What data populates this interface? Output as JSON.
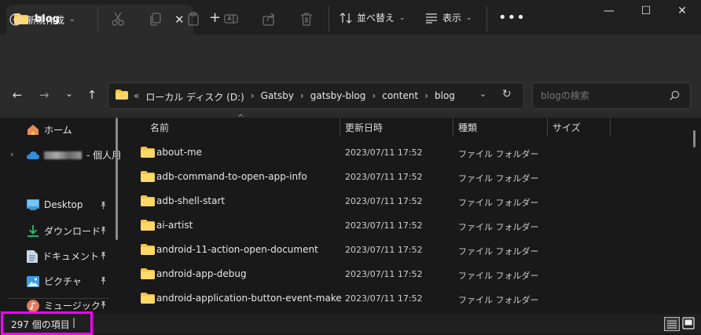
{
  "tab": {
    "title": "blog",
    "close": "✕",
    "new_tab": "+"
  },
  "window": {
    "minimize": "—",
    "maximize": "☐",
    "close": "✕"
  },
  "toolbar": {
    "new_label": "新規作成",
    "sort_label": "並べ替え",
    "view_label": "表示",
    "more": "•••",
    "chevron": "⌄"
  },
  "nav": {
    "back": "←",
    "forward": "→",
    "recent": "⌄",
    "up": "↑"
  },
  "address": {
    "prefix": "«",
    "crumbs": [
      "ローカル ディスク (D:)",
      "Gatsby",
      "gatsby-blog",
      "content",
      "blog"
    ],
    "separator": "›",
    "dropdown": "⌄",
    "refresh": "↻"
  },
  "search": {
    "placeholder": "blogの検索"
  },
  "sidebar": {
    "home": "ホーム",
    "onedrive_suffix": "- 個人用",
    "items": [
      {
        "label": "Desktop",
        "icon": "desktop-icon"
      },
      {
        "label": "ダウンロード",
        "icon": "download-icon"
      },
      {
        "label": "ドキュメント",
        "icon": "document-icon"
      },
      {
        "label": "ピクチャ",
        "icon": "picture-icon"
      },
      {
        "label": "ミュージック",
        "icon": "music-icon"
      }
    ],
    "pin": "📌"
  },
  "columns": {
    "name": "名前",
    "modified": "更新日時",
    "type": "種類",
    "size": "サイズ",
    "sort_caret": "^"
  },
  "rows": [
    {
      "name": "about-me",
      "modified": "2023/07/11 17:52",
      "type": "ファイル フォルダー"
    },
    {
      "name": "adb-command-to-open-app-info",
      "modified": "2023/07/11 17:52",
      "type": "ファイル フォルダー"
    },
    {
      "name": "adb-shell-start",
      "modified": "2023/07/11 17:52",
      "type": "ファイル フォルダー"
    },
    {
      "name": "ai-artist",
      "modified": "2023/07/11 17:52",
      "type": "ファイル フォルダー"
    },
    {
      "name": "android-11-action-open-document",
      "modified": "2023/07/11 17:52",
      "type": "ファイル フォルダー"
    },
    {
      "name": "android-app-debug",
      "modified": "2023/07/11 17:52",
      "type": "ファイル フォルダー"
    },
    {
      "name": "android-application-button-event-make",
      "modified": "2023/07/11 17:52",
      "type": "ファイル フォルダー"
    }
  ],
  "status": {
    "item_count": "297 個の項目",
    "cursor": "|"
  },
  "colors": {
    "folder": "#f6c445",
    "accent_box": "#ff00ff",
    "background": "#191919"
  }
}
